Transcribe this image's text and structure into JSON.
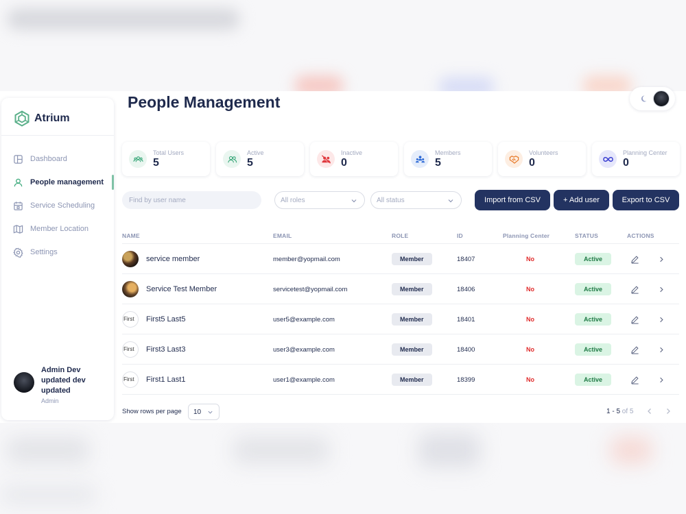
{
  "app": {
    "brand": "Atrium",
    "page_title": "People Management"
  },
  "sidebar": {
    "items": [
      {
        "label": "Dashboard",
        "icon": "dashboard-icon",
        "active": false
      },
      {
        "label": "People management",
        "icon": "people-icon",
        "active": true
      },
      {
        "label": "Service Scheduling",
        "icon": "calendar-icon",
        "active": false
      },
      {
        "label": "Member Location",
        "icon": "map-icon",
        "active": false
      },
      {
        "label": "Settings",
        "icon": "gear-icon",
        "active": false
      }
    ],
    "user": {
      "name": "Admin Dev updated dev updated",
      "role": "Admin"
    }
  },
  "stats": [
    {
      "label": "Total Users",
      "value": "5",
      "icon": "users-icon",
      "color": "#3aa87a",
      "bg": "#eaf6f0"
    },
    {
      "label": "Active",
      "value": "5",
      "icon": "active-users-icon",
      "color": "#3aa87a",
      "bg": "#eaf6f0"
    },
    {
      "label": "Inactive",
      "value": "0",
      "icon": "inactive-users-icon",
      "color": "#e0393e",
      "bg": "#fde8e8"
    },
    {
      "label": "Members",
      "value": "5",
      "icon": "members-icon",
      "color": "#2f6bd6",
      "bg": "#e5edfb"
    },
    {
      "label": "Volunteers",
      "value": "0",
      "icon": "handshake-icon",
      "color": "#e77a2a",
      "bg": "#fdeee2"
    },
    {
      "label": "Planning Center",
      "value": "0",
      "icon": "infinity-icon",
      "color": "#3b3fd1",
      "bg": "#e6e7fb"
    }
  ],
  "filters": {
    "search_placeholder": "Find by user name",
    "roles_value": "All roles",
    "status_value": "All status"
  },
  "buttons": {
    "import": "Import from CSV",
    "add": "+ Add user",
    "export": "Export to CSV"
  },
  "table": {
    "headers": [
      "NAME",
      "EMAIL",
      "ROLE",
      "ID",
      "Planning Center",
      "STATUS",
      "ACTIONS"
    ],
    "rows": [
      {
        "name": "service member",
        "email": "member@yopmail.com",
        "role": "Member",
        "id": "18407",
        "planning_center": "No",
        "status": "Active",
        "avatar": "photo"
      },
      {
        "name": "Service Test Member",
        "email": "servicetest@yopmail.com",
        "role": "Member",
        "id": "18406",
        "planning_center": "No",
        "status": "Active",
        "avatar": "photo2"
      },
      {
        "name": "First5 Last5",
        "email": "user5@example.com",
        "role": "Member",
        "id": "18401",
        "planning_center": "No",
        "status": "Active",
        "avatar": "broken",
        "avatar_alt": "First"
      },
      {
        "name": "First3 Last3",
        "email": "user3@example.com",
        "role": "Member",
        "id": "18400",
        "planning_center": "No",
        "status": "Active",
        "avatar": "broken",
        "avatar_alt": "First"
      },
      {
        "name": "First1 Last1",
        "email": "user1@example.com",
        "role": "Member",
        "id": "18399",
        "planning_center": "No",
        "status": "Active",
        "avatar": "broken",
        "avatar_alt": "First"
      }
    ]
  },
  "pagination": {
    "rows_label": "Show rows per page",
    "rows_value": "10",
    "range": "1 - 5",
    "of": "of 5"
  }
}
